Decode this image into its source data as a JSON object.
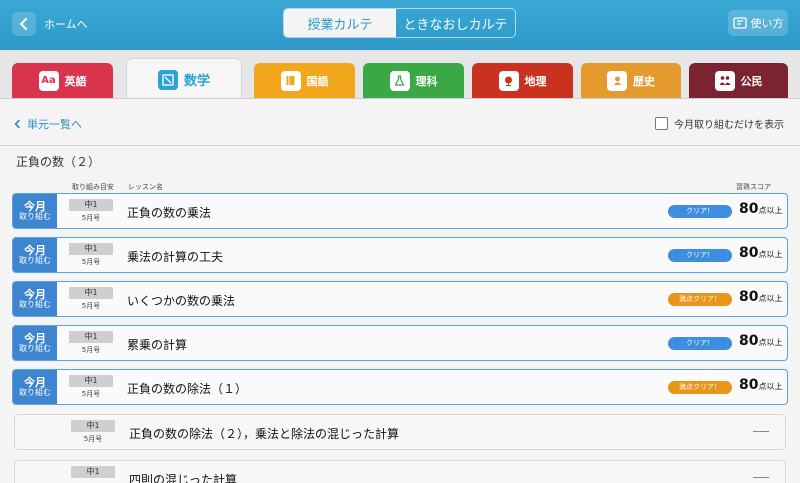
{
  "header": {
    "back_label": "ホームへ",
    "segments": [
      "授業カルテ",
      "ときなおしカルテ"
    ],
    "help_label": "使い方"
  },
  "tabs": [
    {
      "label": "英語",
      "icon": "Aa",
      "color": "#d9344d"
    },
    {
      "label": "数学",
      "icon": "N",
      "color": "#2aa3d3"
    },
    {
      "label": "国語",
      "icon": "",
      "color": "#f2a61c"
    },
    {
      "label": "理科",
      "icon": "",
      "color": "#39a845"
    },
    {
      "label": "地理",
      "icon": "",
      "color": "#c9321f"
    },
    {
      "label": "歴史",
      "icon": "",
      "color": "#e49a2d"
    },
    {
      "label": "公民",
      "icon": "",
      "color": "#7b2331"
    }
  ],
  "content": {
    "unit_link": "単元一覧へ",
    "filter_label": "今月取り組むだけを表示",
    "section_title": "正負の数（２）",
    "col_target": "取り組み目安",
    "col_lesson": "レッスン名",
    "col_score": "習熟スコア"
  },
  "rows": [
    {
      "badge1": "今月",
      "badge2": "取り組む",
      "grade": "中1",
      "month": "5月号",
      "lesson": "正負の数の乗法",
      "clear": "クリア！",
      "clear_color": "blue",
      "score": "80",
      "unit": "点以上"
    },
    {
      "badge1": "今月",
      "badge2": "取り組む",
      "grade": "中1",
      "month": "5月号",
      "lesson": "乗法の計算の工夫",
      "clear": "クリア！",
      "clear_color": "blue",
      "score": "80",
      "unit": "点以上"
    },
    {
      "badge1": "今月",
      "badge2": "取り組む",
      "grade": "中1",
      "month": "5月号",
      "lesson": "いくつかの数の乗法",
      "clear": "満点クリア！",
      "clear_color": "orange",
      "score": "80",
      "unit": "点以上"
    },
    {
      "badge1": "今月",
      "badge2": "取り組む",
      "grade": "中1",
      "month": "5月号",
      "lesson": "累乗の計算",
      "clear": "クリア！",
      "clear_color": "blue",
      "score": "80",
      "unit": "点以上"
    },
    {
      "badge1": "今月",
      "badge2": "取り組む",
      "grade": "中1",
      "month": "5月号",
      "lesson": "正負の数の除法（１）",
      "clear": "満点クリア！",
      "clear_color": "orange",
      "score": "80",
      "unit": "点以上"
    },
    {
      "grade": "中1",
      "month": "5月号",
      "lesson": "正負の数の除法（２），乗法と除法の混じった計算"
    },
    {
      "grade": "中1",
      "month": "",
      "lesson": "四則の混じった計算"
    }
  ]
}
